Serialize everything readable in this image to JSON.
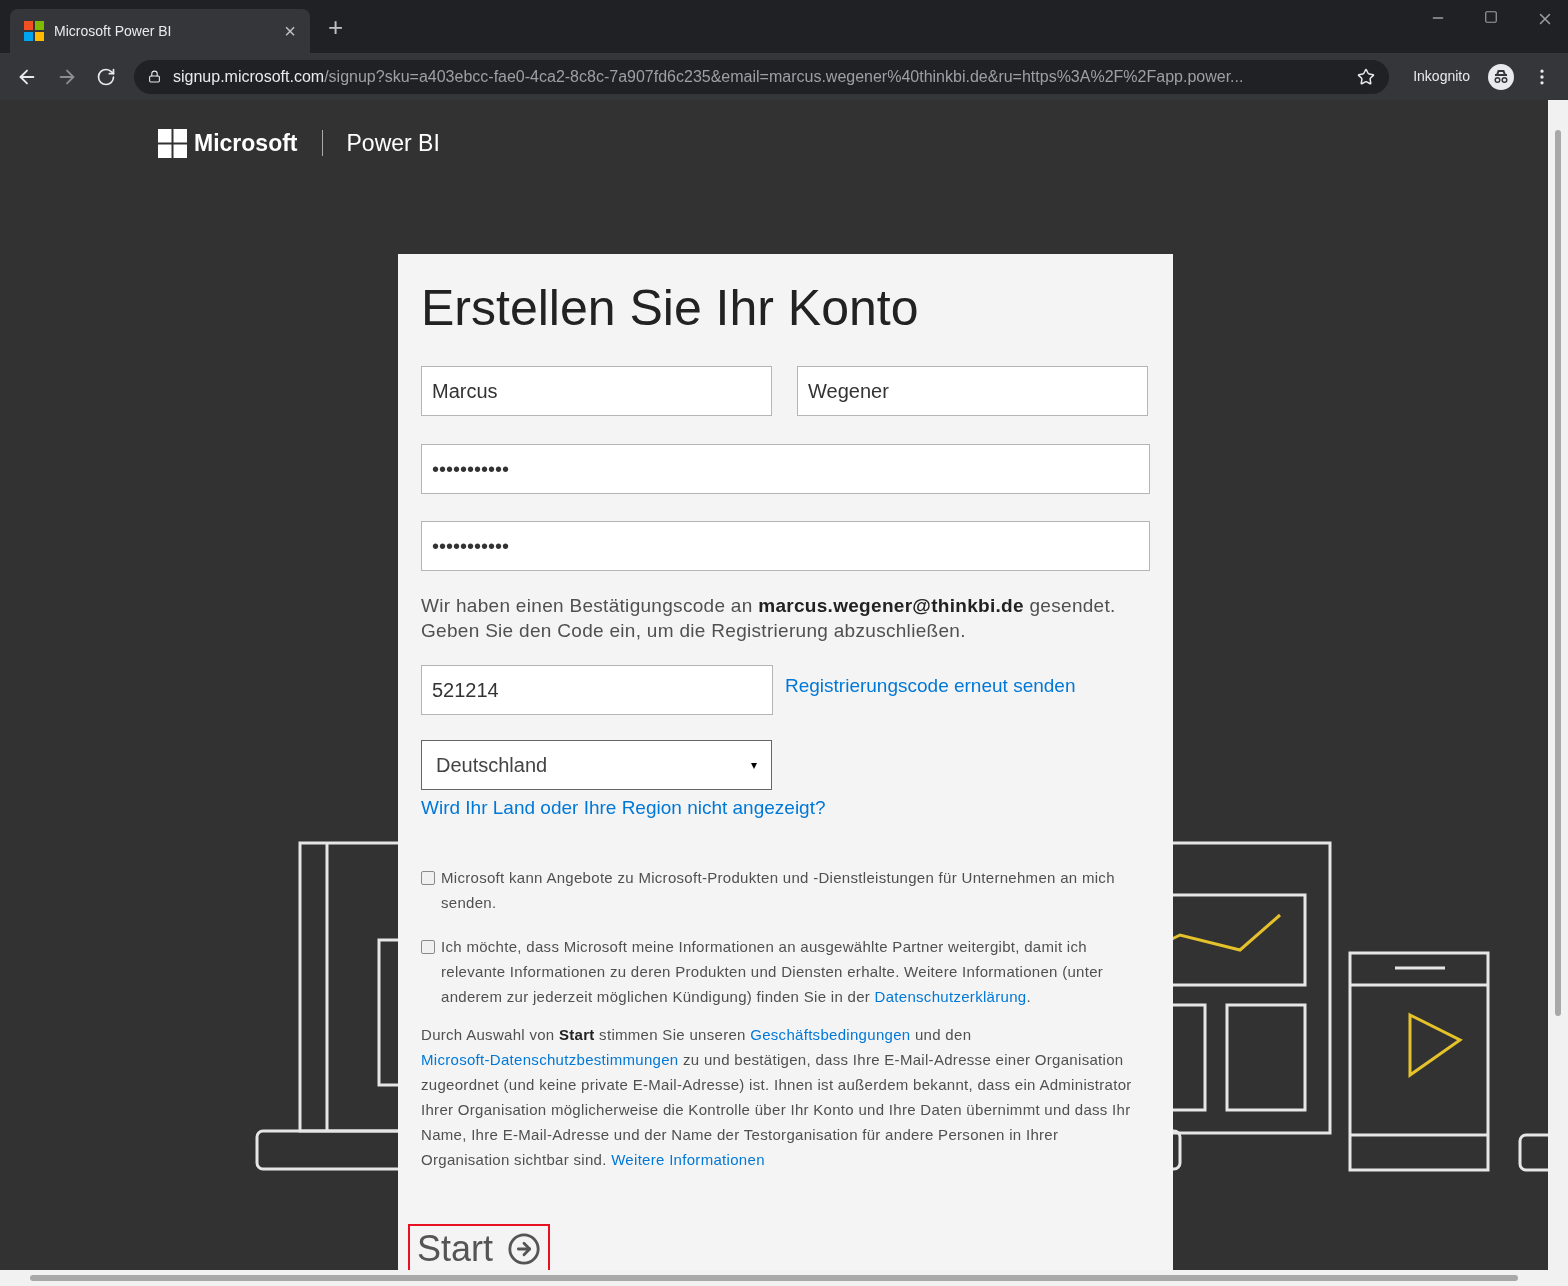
{
  "browser": {
    "tab": {
      "title": "Microsoft Power BI",
      "close": "×"
    },
    "new_tab": "+",
    "url_host": "signup.microsoft.com",
    "url_rest": "/signup?sku=a403ebcc-fae0-4ca2-8c8c-7a907fd6c235&email=marcus.wegener%40thinkbi.de&ru=https%3A%2F%2Fapp.power...",
    "profile": "Inkognito"
  },
  "header": {
    "brand": "Microsoft",
    "product": "Power BI"
  },
  "form": {
    "title": "Erstellen Sie Ihr Konto",
    "first_name": "Marcus",
    "last_name": "Wegener",
    "password": "•••••••••••",
    "password_confirm": "•••••••••••",
    "notice": [
      {
        "kind": "text",
        "text": "Wir haben einen Bestätigungscode an "
      },
      {
        "kind": "strong",
        "text": "marcus.wegener@thinkbi.de"
      },
      {
        "kind": "text",
        "text": " gesendet. Geben Sie den Code ein, um die Registrierung abzuschließen."
      }
    ],
    "code": "521214",
    "resend_link": "Registrierungscode erneut senden",
    "country": "Deutschland",
    "country_caret": "▾",
    "country_link": "Wird Ihr Land oder Ihre Region nicht angezeigt?",
    "consents": [
      {
        "checked": false,
        "segments": [
          {
            "kind": "text",
            "text": "Microsoft kann Angebote zu Microsoft-Produkten und -Dienstleistungen für Unternehmen an mich senden."
          }
        ]
      },
      {
        "checked": false,
        "segments": [
          {
            "kind": "text",
            "text": "Ich möchte, dass Microsoft meine Informationen an ausgewählte Partner weitergibt, damit ich relevante Informationen zu deren Produkten und Diensten erhalte. Weitere Informationen (unter anderem zur jederzeit möglichen Kündigung) finden Sie in der "
          },
          {
            "kind": "link",
            "text": "Datenschutzerklärung"
          },
          {
            "kind": "text",
            "text": "."
          }
        ]
      }
    ],
    "terms": [
      {
        "kind": "text",
        "text": "Durch Auswahl von "
      },
      {
        "kind": "strong",
        "text": "Start"
      },
      {
        "kind": "text",
        "text": " stimmen Sie unseren "
      },
      {
        "kind": "link",
        "text": "Geschäftsbedingungen"
      },
      {
        "kind": "text",
        "text": " und den "
      },
      {
        "kind": "link",
        "text": "Microsoft-Datenschutzbestimmungen"
      },
      {
        "kind": "text",
        "text": " zu und bestätigen, dass Ihre E-Mail-Adresse einer Organisation zugeordnet (und keine private E-Mail-Adresse) ist. Ihnen ist außerdem bekannt, dass ein Administrator Ihrer Organisation möglicherweise die Kontrolle über Ihr Konto und Ihre Daten übernimmt und dass Ihr Name, Ihre E-Mail-Adresse und der Name der Testorganisation für andere Personen in Ihrer Organisation sichtbar sind. "
      },
      {
        "kind": "link",
        "text": "Weitere Informationen"
      }
    ],
    "submit": "Start"
  }
}
